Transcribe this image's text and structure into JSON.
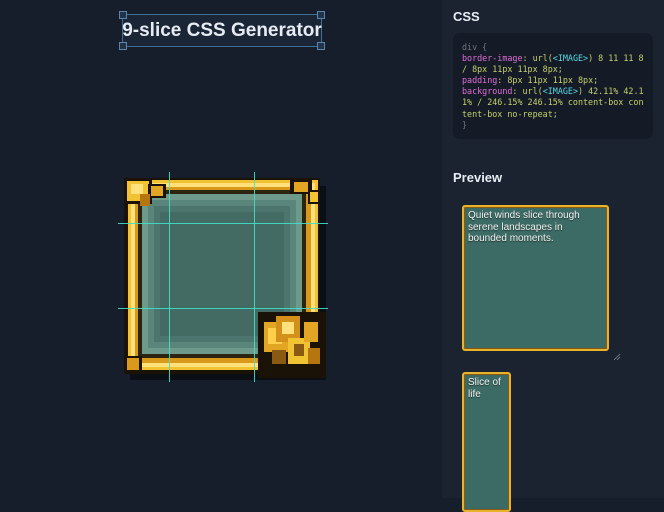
{
  "title": "9-slice CSS Generator",
  "css_heading": "CSS",
  "preview_heading": "Preview",
  "code": {
    "selector_open": "div {",
    "border_image_prop": "border-image",
    "border_image_fn": "url(",
    "border_image_img": "<IMAGE>",
    "border_image_rest": ") 8 11 11 8 / 8px 11px 11px 8px;",
    "padding_prop": "padding",
    "padding_val": "8px 11px 11px 8px;",
    "background_prop": "background",
    "background_fn": "url(",
    "background_img": "<IMAGE>",
    "background_rest": ") 42.11% 42.11% / 246.15% 246.15% content-box content-box no-repeat;",
    "selector_close": "}"
  },
  "preview": {
    "large_text": "Quiet winds slice through serene landscapes in bounded moments.",
    "small_text": "Slice of life"
  },
  "colors": {
    "accent_guide": "#3fe0c8",
    "frame_gold": "#e8b22a",
    "panel_fill": "#3c6b65"
  },
  "icons": [
    "resize-grip-icon"
  ]
}
